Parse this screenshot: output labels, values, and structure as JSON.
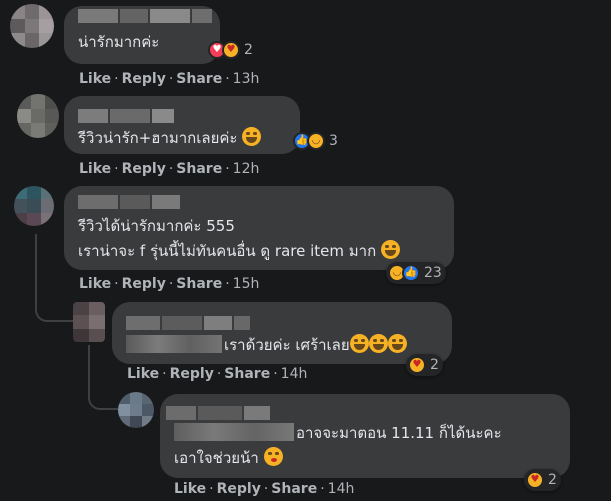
{
  "colors": {
    "background": "#18191a",
    "bubble": "#3a3b3c",
    "text": "#e4e6eb",
    "muted": "#b0b3b8"
  },
  "actions": {
    "like": "Like",
    "reply": "Reply",
    "sep": "·"
  },
  "comments": [
    {
      "text_line1": "น่ารักมากค่ะ",
      "time": "13h",
      "reactions": [
        "heart-icon",
        "care-icon"
      ],
      "reaction_count": "2"
    },
    {
      "text_line1": "รีวิวน่ารัก+ฮามากเลยค่ะ",
      "time": "12h",
      "reactions": [
        "like-icon",
        "haha-icon"
      ],
      "reaction_count": "3"
    },
    {
      "text_line1": "รีวิวได้น่ารักมากค่ะ 555",
      "text_line2": "เราน่าจะ f รุ่นนี้ไม่ทันคนอื่น ดู rare item มาก",
      "time": "15h",
      "reactions": [
        "haha-icon",
        "like-icon"
      ],
      "reaction_count": "23"
    },
    {
      "text_line1": "เราด้วยค่ะ เศร้าเลย",
      "time": "14h",
      "reactions": [
        "care-icon"
      ],
      "reaction_count": "2"
    },
    {
      "text_line1": "อาจจะมาตอน 11.11 ก็ได้นะคะ",
      "text_line2": "เอาใจช่วยน้า",
      "time": "14h",
      "reactions": [
        "care-icon"
      ],
      "reaction_count": "2"
    }
  ],
  "share_label": "Share"
}
